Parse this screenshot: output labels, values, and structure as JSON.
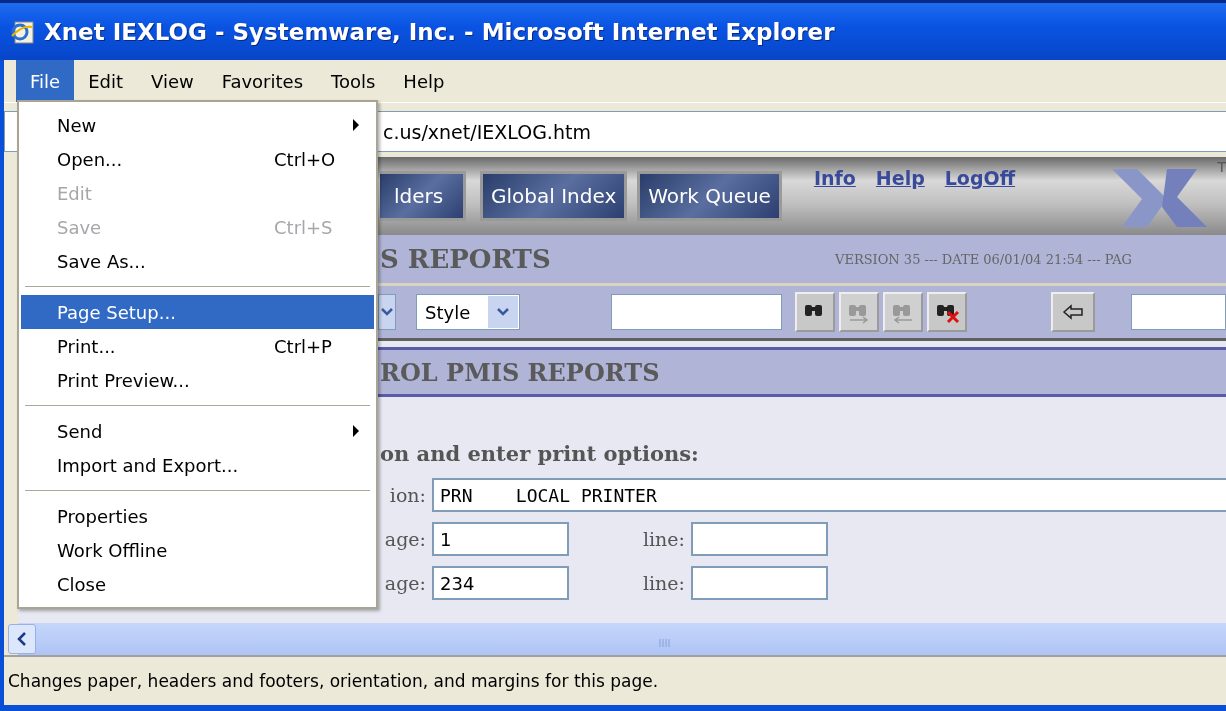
{
  "window": {
    "title": "Xnet IEXLOG - Systemware, Inc. - Microsoft Internet Explorer"
  },
  "menubar": [
    {
      "label": "File",
      "selected": true
    },
    {
      "label": "Edit",
      "selected": false
    },
    {
      "label": "View",
      "selected": false
    },
    {
      "label": "Favorites",
      "selected": false
    },
    {
      "label": "Tools",
      "selected": false
    },
    {
      "label": "Help",
      "selected": false
    }
  ],
  "file_menu": [
    {
      "kind": "item",
      "label": "New",
      "disabled": false,
      "selected": false,
      "submenu": true
    },
    {
      "kind": "item",
      "label": "Open...",
      "shortcut": "Ctrl+O",
      "disabled": false,
      "selected": false,
      "submenu": false
    },
    {
      "kind": "item",
      "label": "Edit",
      "disabled": true,
      "selected": false,
      "submenu": false
    },
    {
      "kind": "item",
      "label": "Save",
      "shortcut": "Ctrl+S",
      "disabled": true,
      "selected": false,
      "submenu": false
    },
    {
      "kind": "item",
      "label": "Save As...",
      "disabled": false,
      "selected": false,
      "submenu": false
    },
    {
      "kind": "separator"
    },
    {
      "kind": "item",
      "label": "Page Setup...",
      "disabled": false,
      "selected": true,
      "submenu": false
    },
    {
      "kind": "item",
      "label": "Print...",
      "shortcut": "Ctrl+P",
      "disabled": false,
      "selected": false,
      "submenu": false
    },
    {
      "kind": "item",
      "label": "Print Preview...",
      "disabled": false,
      "selected": false,
      "submenu": false
    },
    {
      "kind": "separator"
    },
    {
      "kind": "item",
      "label": "Send",
      "disabled": false,
      "selected": false,
      "submenu": true
    },
    {
      "kind": "item",
      "label": "Import and Export...",
      "disabled": false,
      "selected": false,
      "submenu": false
    },
    {
      "kind": "separator"
    },
    {
      "kind": "item",
      "label": "Properties",
      "disabled": false,
      "selected": false,
      "submenu": false
    },
    {
      "kind": "item",
      "label": "Work Offline",
      "disabled": false,
      "selected": false,
      "submenu": false
    },
    {
      "kind": "item",
      "label": "Close",
      "disabled": false,
      "selected": false,
      "submenu": false
    }
  ],
  "address": {
    "value": "c.us/xnet/IEXLOG.htm"
  },
  "nav_buttons": [
    "lders",
    "Global Index",
    "Work Queue"
  ],
  "nav_links": [
    "Info",
    "Help",
    "LogOff"
  ],
  "logo": {
    "mark": "T"
  },
  "header": {
    "title": "S REPORTS",
    "version": "VERSION 35 --- DATE 06/01/04 21:54 --- PAG"
  },
  "toolbar": {
    "style_select": "Style",
    "find_buttons": [
      {
        "kind": "find",
        "disabled": false
      },
      {
        "kind": "find-next",
        "disabled": true
      },
      {
        "kind": "find-prev",
        "disabled": true
      },
      {
        "kind": "clear",
        "disabled": false
      }
    ]
  },
  "section_title": "ROL PMIS REPORTS",
  "instruction": "on and enter print options:",
  "destination": {
    "label": "ion:",
    "value": "PRN    LOCAL PRINTER"
  },
  "page_rows": [
    {
      "label": "age:",
      "value": "1",
      "line_label": "line:",
      "line_value": ""
    },
    {
      "label": "age:",
      "value": "234",
      "line_label": "line:",
      "line_value": ""
    }
  ],
  "status_bar": "Changes paper, headers and footers, orientation, and margins for this page."
}
